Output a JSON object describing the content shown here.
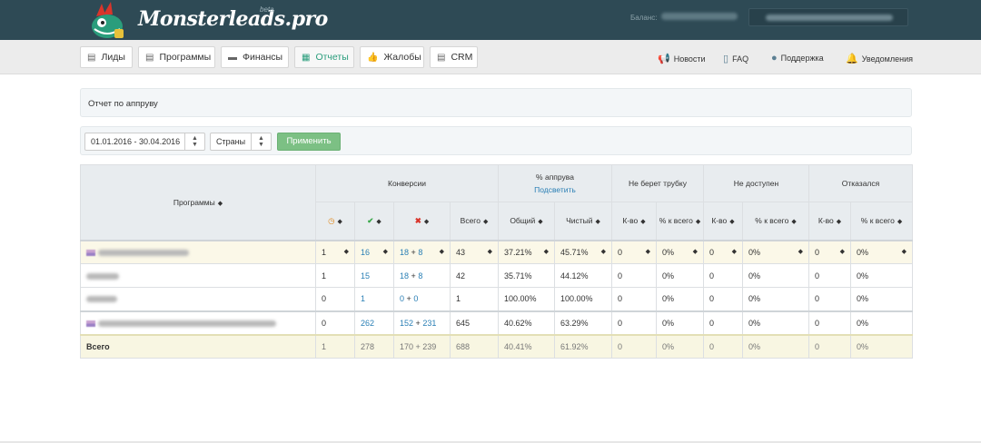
{
  "header": {
    "logo_text": "Monsterleads.pro",
    "beta": "beta",
    "balance_label": "Баланс:"
  },
  "nav": {
    "tabs": [
      {
        "label": "Лиды",
        "icon": "table-icon"
      },
      {
        "label": "Программы",
        "icon": "table-icon"
      },
      {
        "label": "Финансы",
        "icon": "briefcase-icon"
      },
      {
        "label": "Отчеты",
        "icon": "calendar-icon",
        "active": true
      },
      {
        "label": "Жалобы",
        "icon": "thumbs-up-icon"
      },
      {
        "label": "CRM",
        "icon": "table-icon"
      }
    ],
    "links": [
      {
        "label": "Новости",
        "icon": "megaphone-icon"
      },
      {
        "label": "FAQ",
        "icon": "document-icon"
      },
      {
        "label": "Поддержка",
        "icon": "chat-icon"
      },
      {
        "label": "Уведомления",
        "icon": "bell-icon"
      }
    ]
  },
  "report": {
    "title": "Отчет по аппруву"
  },
  "filters": {
    "date_range": "01.01.2016 - 30.04.2016",
    "countries": "Страны",
    "apply": "Применить"
  },
  "table": {
    "headers": {
      "programs": "Программы",
      "conversions": "Конверсии",
      "approve": "% аппрува",
      "highlight": "Подсветить",
      "no_answer": "Не берет трубку",
      "unavailable": "Не доступен",
      "refused": "Отказался",
      "total": "Всего",
      "general": "Общий",
      "clean": "Чистый",
      "count": "К-во",
      "pct_total": "% к всего",
      "pct_total_alt": "% к всего"
    },
    "rows": [
      {
        "pending": "1",
        "approved": "16",
        "rej_a": "18",
        "rej_b": "8",
        "total": "43",
        "general": "37.21%",
        "clean": "45.71%",
        "na_c": "0",
        "na_p": "0%",
        "un_c": "0",
        "un_p": "0%",
        "rf_c": "0",
        "rf_p": "0%"
      },
      {
        "pending": "1",
        "approved": "15",
        "rej_a": "18",
        "rej_b": "8",
        "total": "42",
        "general": "35.71%",
        "clean": "44.12%",
        "na_c": "0",
        "na_p": "0%",
        "un_c": "0",
        "un_p": "0%",
        "rf_c": "0",
        "rf_p": "0%"
      },
      {
        "pending": "0",
        "approved": "1",
        "rej_a": "0",
        "rej_b": "0",
        "total": "1",
        "general": "100.00%",
        "clean": "100.00%",
        "na_c": "0",
        "na_p": "0%",
        "un_c": "0",
        "un_p": "0%",
        "rf_c": "0",
        "rf_p": "0%"
      },
      {
        "pending": "0",
        "approved": "262",
        "rej_a": "152",
        "rej_b": "231",
        "total": "645",
        "general": "40.62%",
        "clean": "63.29%",
        "na_c": "0",
        "na_p": "0%",
        "un_c": "0",
        "un_p": "0%",
        "rf_c": "0",
        "rf_p": "0%"
      }
    ],
    "totals": {
      "label": "Всего",
      "pending": "1",
      "approved": "278",
      "rej_a": "170",
      "rej_b": "239",
      "total": "688",
      "general": "40.41%",
      "clean": "61.92%",
      "na_c": "0",
      "na_p": "0%",
      "un_c": "0",
      "un_p": "0%",
      "rf_c": "0",
      "rf_p": "0%"
    }
  },
  "colors": {
    "header_bg": "#2e4a55",
    "accent": "#2a9d7c",
    "link": "#2a7fb5",
    "apply_btn": "#7cc084"
  }
}
